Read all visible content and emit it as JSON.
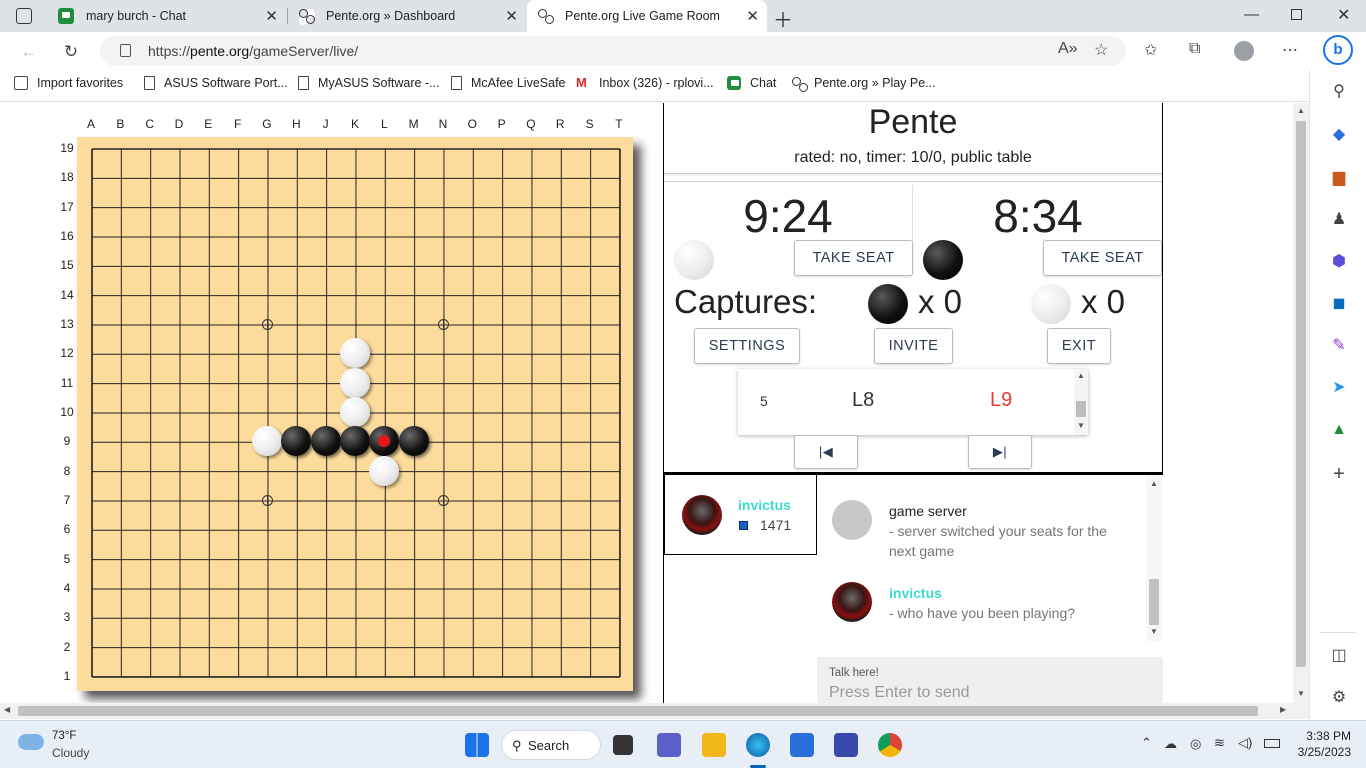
{
  "browser": {
    "tabs": [
      {
        "title": "mary burch - Chat",
        "icon": "chat-icon"
      },
      {
        "title": "Pente.org » Dashboard",
        "icon": "pente-icon"
      },
      {
        "title": "Pente.org Live Game Room",
        "icon": "pente-icon",
        "active": true
      }
    ],
    "url_prefix": "https://",
    "url_host": "pente.org",
    "url_path": "/gameServer/live/",
    "favorites": [
      {
        "label": "Import favorites",
        "icon": "import-icon"
      },
      {
        "label": "ASUS Software Port...",
        "icon": "doc-icon"
      },
      {
        "label": "MyASUS Software -...",
        "icon": "doc-icon"
      },
      {
        "label": "McAfee LiveSafe",
        "icon": "doc-icon"
      },
      {
        "label": "Inbox (326) - rplovi...",
        "icon": "gmail-icon"
      },
      {
        "label": "Chat",
        "icon": "chat-icon"
      },
      {
        "label": "Pente.org » Play Pe...",
        "icon": "pente-icon"
      }
    ]
  },
  "board": {
    "columns": [
      "A",
      "B",
      "C",
      "D",
      "E",
      "F",
      "G",
      "H",
      "J",
      "K",
      "L",
      "M",
      "N",
      "O",
      "P",
      "Q",
      "R",
      "S",
      "T"
    ],
    "rows": [
      "19",
      "18",
      "17",
      "16",
      "15",
      "14",
      "13",
      "12",
      "11",
      "10",
      "9",
      "8",
      "7",
      "6",
      "5",
      "4",
      "3",
      "2",
      "1"
    ],
    "size": 19,
    "board_color": "#fcdb9d",
    "stones": [
      {
        "col": "K",
        "row": 12,
        "color": "white"
      },
      {
        "col": "K",
        "row": 11,
        "color": "white"
      },
      {
        "col": "K",
        "row": 10,
        "color": "white"
      },
      {
        "col": "G",
        "row": 9,
        "color": "white"
      },
      {
        "col": "H",
        "row": 9,
        "color": "black"
      },
      {
        "col": "J",
        "row": 9,
        "color": "black"
      },
      {
        "col": "K",
        "row": 9,
        "color": "black"
      },
      {
        "col": "L",
        "row": 9,
        "color": "black",
        "last_move": true
      },
      {
        "col": "M",
        "row": 9,
        "color": "black"
      },
      {
        "col": "L",
        "row": 8,
        "color": "white"
      }
    ],
    "star_points": [
      {
        "col": "G",
        "row": 13
      },
      {
        "col": "N",
        "row": 13
      },
      {
        "col": "G",
        "row": 7
      },
      {
        "col": "N",
        "row": 7
      }
    ]
  },
  "game": {
    "title": "Pente",
    "info": "rated: no, timer: 10/0, public table",
    "clock_white": "9:24",
    "clock_black": "8:34",
    "take_seat_label": "TAKE SEAT",
    "captures_label": "Captures:",
    "captures_black": "x 0",
    "captures_white": "x 0",
    "settings_label": "SETTINGS",
    "invite_label": "INVITE",
    "exit_label": "EXIT",
    "moves": [
      {
        "num": "5",
        "black": "L8",
        "white": "L9"
      }
    ]
  },
  "players": [
    {
      "name": "invictus",
      "rating": "1471",
      "rating_color": "#1565c0"
    }
  ],
  "chat": {
    "messages": [
      {
        "author": "game server",
        "text": "- server switched your seats for the next game",
        "author_color": "#222222"
      },
      {
        "author": "invictus",
        "text": "- who have you been playing?",
        "author_color": "#3ddbcf"
      }
    ],
    "input_label": "Talk here!",
    "input_placeholder": "Press Enter to send"
  },
  "taskbar": {
    "weather_temp": "73°F",
    "weather_desc": "Cloudy",
    "search_label": "Search",
    "time": "3:38 PM",
    "date": "3/25/2023"
  }
}
